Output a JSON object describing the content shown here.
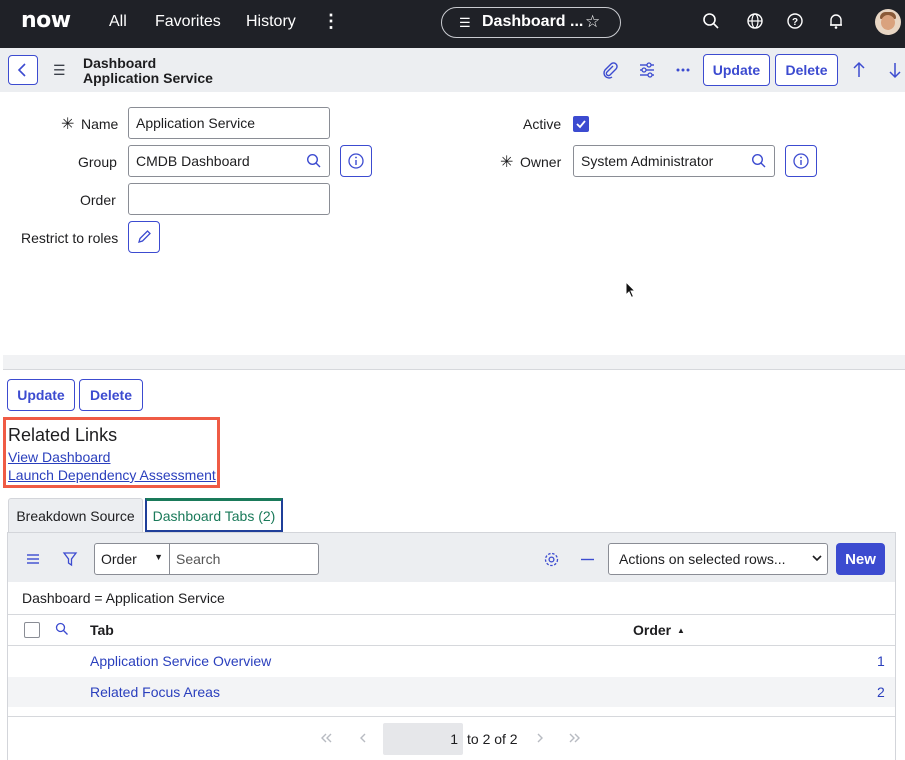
{
  "topnav": {
    "logo": "now",
    "links": [
      "All",
      "Favorites",
      "History"
    ],
    "more_glyph": "⋮",
    "dashboard_pill": "Dashboard ...",
    "icons": [
      "search-icon",
      "globe-icon",
      "help-icon",
      "bell-icon",
      "avatar"
    ]
  },
  "form_header": {
    "record_type": "Dashboard",
    "record_name": "Application Service",
    "update_label": "Update",
    "delete_label": "Delete"
  },
  "form": {
    "name_label": "Name",
    "name_value": "Application Service",
    "group_label": "Group",
    "group_value": "CMDB Dashboard",
    "order_label": "Order",
    "order_value": "",
    "restrict_label": "Restrict to roles",
    "active_label": "Active",
    "active_checked": true,
    "owner_label": "Owner",
    "owner_value": "System Administrator",
    "required_mark": "✳"
  },
  "bottom_buttons": {
    "update_label": "Update",
    "delete_label": "Delete"
  },
  "related_links": {
    "title": "Related Links",
    "links": [
      "View Dashboard",
      "Launch Dependency Assessment"
    ]
  },
  "tabs": [
    {
      "label": "Breakdown Source",
      "active": false
    },
    {
      "label": "Dashboard Tabs (2)",
      "active": true
    }
  ],
  "list": {
    "search_field_value": "Order",
    "search_placeholder": "Search",
    "actions_value": "Actions on selected rows...",
    "new_label": "New",
    "condition": "Dashboard = Application Service",
    "columns": [
      "Tab",
      "Order"
    ],
    "sort_indicator": "▲",
    "rows": [
      {
        "tab": "Application Service Overview",
        "order": "1"
      },
      {
        "tab": "Related Focus Areas",
        "order": "2"
      }
    ],
    "pagination": {
      "current": "1",
      "range_text": "to 2 of 2"
    }
  },
  "colors": {
    "nav_bg": "#1f2127",
    "accent": "#3c4bd0",
    "highlight_box": "#ef5b45",
    "active_tab": "#1a7a5a"
  }
}
